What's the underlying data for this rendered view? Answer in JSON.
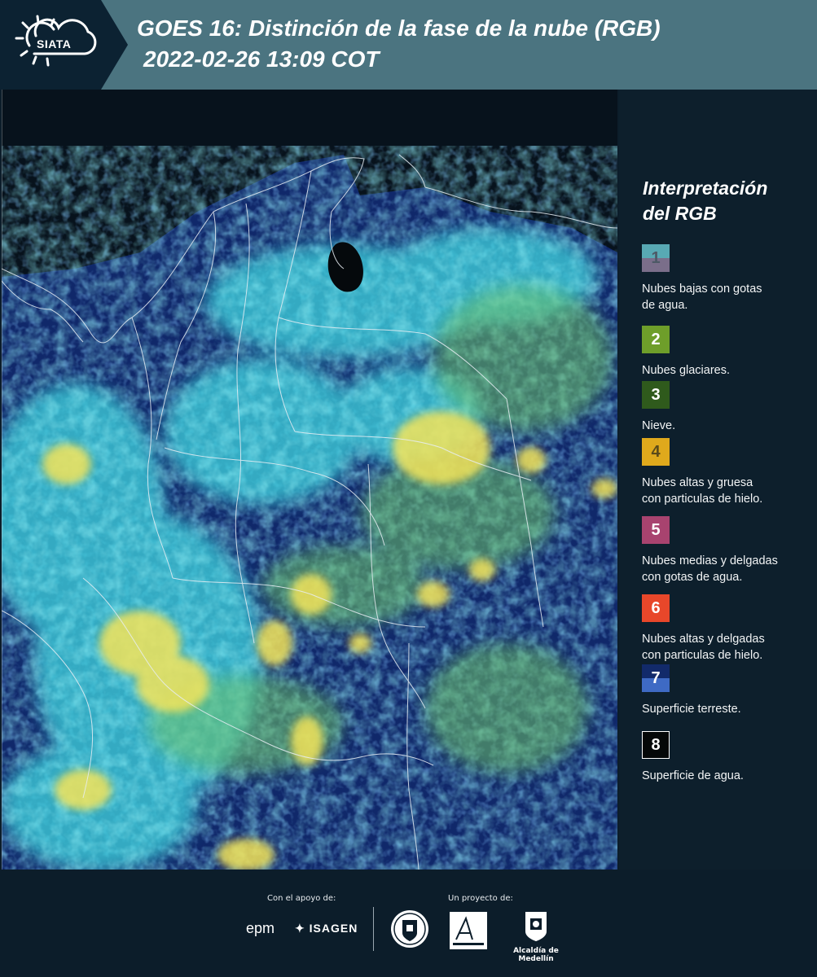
{
  "header": {
    "logo_text": "SIATA",
    "title_line1": "GOES 16: Distinción de la fase de la nube (RGB)",
    "title_line2": "2022-02-26 13:09 COT"
  },
  "legend": {
    "title_line1": "Interpretación",
    "title_line2": "del RGB",
    "items": [
      {
        "number": "1",
        "lines": [
          "Nubes bajas con gotas",
          "de agua."
        ],
        "color_top": "#58a9b4",
        "color_bottom": "#7a6e8a",
        "text_color": "#4d5966"
      },
      {
        "number": "2",
        "lines": [
          "Nubes glaciares."
        ],
        "color_top": "#6e9e2a",
        "color_bottom": "#6e9e2a",
        "text_color": "#ffffff"
      },
      {
        "number": "3",
        "lines": [
          "Nieve."
        ],
        "color_top": "#2f5a1c",
        "color_bottom": "#2f5a1c",
        "text_color": "#ffffff"
      },
      {
        "number": "4",
        "lines": [
          "Nubes altas y gruesa",
          "con particulas de hielo."
        ],
        "color_top": "#dfa91c",
        "color_bottom": "#dfa91c",
        "text_color": "#5a4a1a"
      },
      {
        "number": "5",
        "lines": [
          "Nubes medias y delgadas",
          "con gotas de agua."
        ],
        "color_top": "#a8436f",
        "color_bottom": "#a8436f",
        "text_color": "#ffffff"
      },
      {
        "number": "6",
        "lines": [
          "Nubes altas y delgadas",
          "con particulas de hielo."
        ],
        "color_top": "#e8472a",
        "color_bottom": "#e8472a",
        "text_color": "#ffffff"
      },
      {
        "number": "7",
        "lines": [
          "Superficie terreste."
        ],
        "color_top": "#122a6a",
        "color_bottom": "#3e6ac4",
        "text_color": "#ffffff"
      },
      {
        "number": "8",
        "lines": [
          "Superficie de agua."
        ],
        "color_top": "#050808",
        "color_bottom": "#050808",
        "text_color": "#ffffff"
      }
    ]
  },
  "footer": {
    "support_label": "Con el apoyo de:",
    "project_label": "Un proyecto de:",
    "epm": "epm",
    "isagen": "ISAGEN",
    "alcaldia": "Alcaldía de Medellín"
  }
}
